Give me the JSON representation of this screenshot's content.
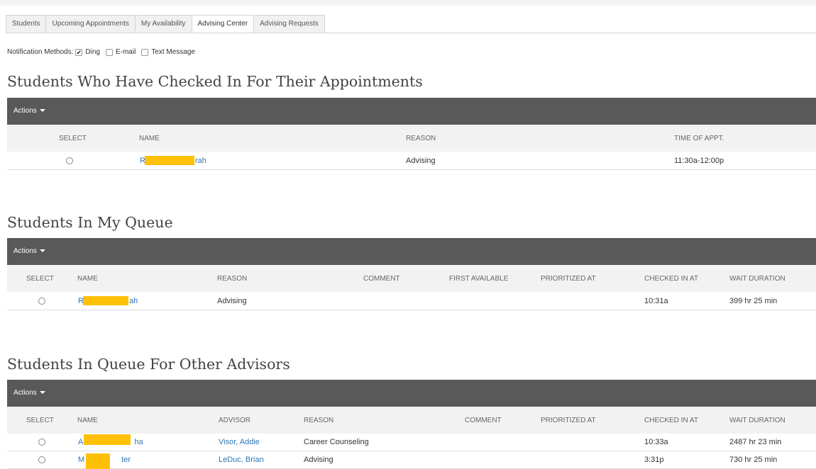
{
  "tabs": [
    "Students",
    "Upcoming Appointments",
    "My Availability",
    "Advising Center",
    "Advising Requests"
  ],
  "active_tab": "Advising Center",
  "notification": {
    "label": "Notification Methods:",
    "options": [
      {
        "label": "Ding",
        "checked": true
      },
      {
        "label": "E-mail",
        "checked": false
      },
      {
        "label": "Text Message",
        "checked": false
      }
    ]
  },
  "actions_label": "Actions",
  "checked_in": {
    "title": "Students Who Have Checked In For Their Appointments",
    "headers": {
      "select": "SELECT",
      "name": "NAME",
      "reason": "REASON",
      "time": "TIME OF APPT."
    },
    "rows": [
      {
        "name_start": "R",
        "name_end": "rah",
        "reason": "Advising",
        "time": "11:30a-12:00p"
      }
    ]
  },
  "my_queue": {
    "title": "Students In My Queue",
    "headers": {
      "select": "SELECT",
      "name": "NAME",
      "reason": "REASON",
      "comment": "COMMENT",
      "first_available": "FIRST AVAILABLE",
      "prioritized_at": "PRIORITIZED AT",
      "checked_in_at": "CHECKED IN AT",
      "wait_duration": "WAIT DURATION"
    },
    "rows": [
      {
        "name_start": "R",
        "name_end": "ah",
        "reason": "Advising",
        "comment": "",
        "first_available": "",
        "prioritized_at": "",
        "checked_in_at": "10:31a",
        "wait_duration": "399 hr 25 min"
      }
    ]
  },
  "other_queue": {
    "title": "Students In Queue For Other Advisors",
    "headers": {
      "select": "SELECT",
      "name": "NAME",
      "advisor": "ADVISOR",
      "reason": "REASON",
      "comment": "COMMENT",
      "prioritized_at": "PRIORITIZED AT",
      "checked_in_at": "CHECKED IN AT",
      "wait_duration": "WAIT DURATION"
    },
    "rows": [
      {
        "name_start": "A",
        "name_end": "ha",
        "advisor": "Visor, Addie",
        "reason": "Career Counseling",
        "comment": "",
        "prioritized_at": "",
        "checked_in_at": "10:33a",
        "wait_duration": "2487 hr 23 min"
      },
      {
        "name_start": "M",
        "name_end": "ter",
        "advisor": "LeDuc, Brian",
        "reason": "Advising",
        "comment": "",
        "prioritized_at": "",
        "checked_in_at": "3:31p",
        "wait_duration": "730 hr 25 min"
      }
    ]
  },
  "colors": {
    "action_bar": "#595959",
    "header_row": "#f2f2f2",
    "link": "#2e75b6",
    "redaction": "#ffc107"
  }
}
